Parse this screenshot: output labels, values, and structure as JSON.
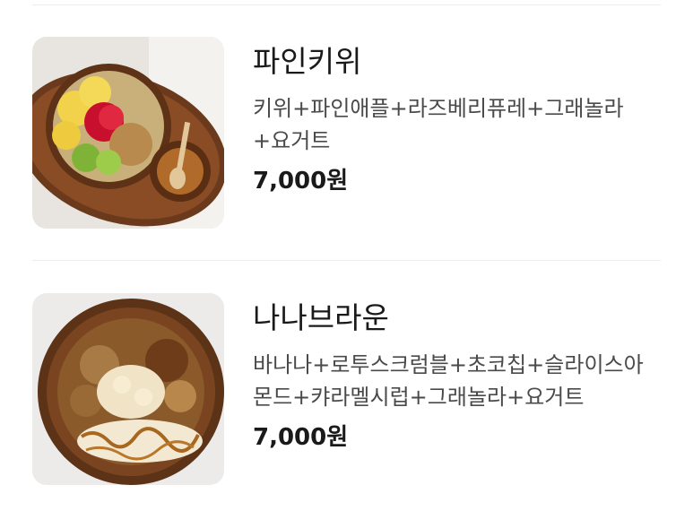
{
  "menu": {
    "items": [
      {
        "name": "파인키위",
        "description": "키위+파인애플+라즈베리퓨레+그래놀라+요거트",
        "price": "7,000원",
        "image": "pineapple-kiwi-granola-bowl-photo"
      },
      {
        "name": "나나브라운",
        "description": "바나나+로투스크럼블+초코칩+슬라이스아몬드+캬라멜시럽+그래놀라+요거트",
        "price": "7,000원",
        "image": "banana-caramel-granola-bowl-photo"
      }
    ]
  }
}
